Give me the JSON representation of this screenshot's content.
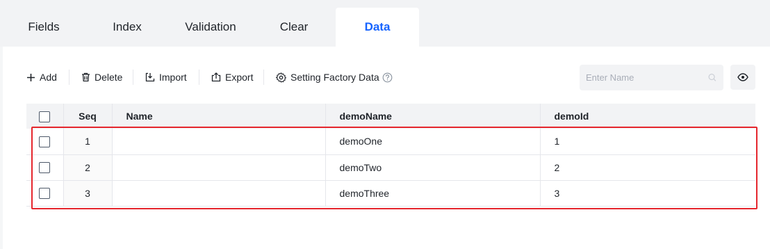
{
  "tabs": [
    {
      "label": "Fields"
    },
    {
      "label": "Index"
    },
    {
      "label": "Validation"
    },
    {
      "label": "Clear"
    },
    {
      "label": "Data"
    }
  ],
  "active_tab": "Data",
  "toolbar": {
    "add_label": "Add",
    "delete_label": "Delete",
    "import_label": "Import",
    "export_label": "Export",
    "setting_label": "Setting Factory Data"
  },
  "search": {
    "placeholder": "Enter Name",
    "value": ""
  },
  "table": {
    "columns": [
      "Seq",
      "Name",
      "demoName",
      "demoId"
    ],
    "rows": [
      {
        "seq": "1",
        "name": "",
        "demoName": "demoOne",
        "demoId": "1"
      },
      {
        "seq": "2",
        "name": "",
        "demoName": "demoTwo",
        "demoId": "2"
      },
      {
        "seq": "3",
        "name": "",
        "demoName": "demoThree",
        "demoId": "3"
      }
    ]
  },
  "colors": {
    "accent": "#1664ff",
    "highlight": "#e5262d",
    "tab_bar_bg": "#f2f3f5"
  }
}
